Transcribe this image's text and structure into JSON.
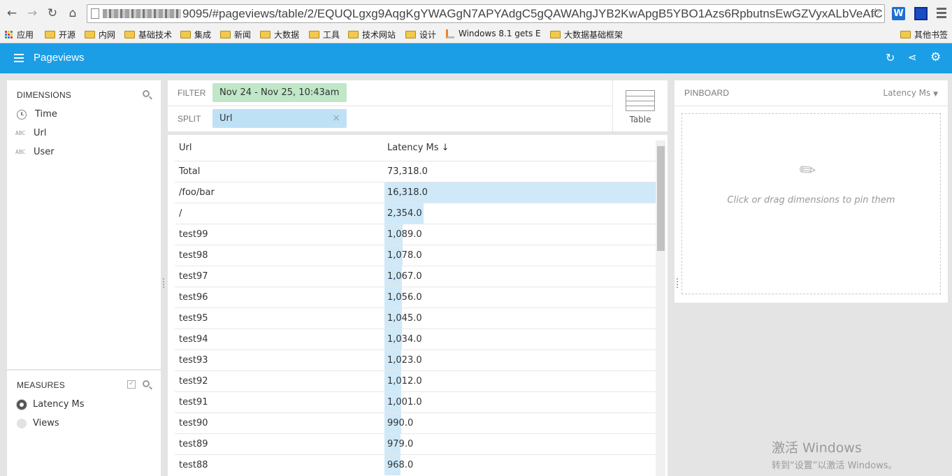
{
  "browser": {
    "url_visible": "9095/#pageviews/table/2/EQUQLgxg9AqgKgYWAGgN7APYAdgC5gQAWAhgJYB2KwApgB5YBO1Azs6RpbutnsEwGZVyxALbVeAfC",
    "bookmarks": [
      "应用",
      "开源",
      "内网",
      "基础技术",
      "集成",
      "新闻",
      "大数据",
      "工具",
      "技术网站",
      "设计",
      "Windows 8.1 gets E",
      "大数据基础框架",
      "其他书签"
    ]
  },
  "app": {
    "title": "Pageviews"
  },
  "dimensions": {
    "title": "DIMENSIONS",
    "items": [
      {
        "icon": "clock-icon",
        "label": "Time"
      },
      {
        "icon": "abc-icon",
        "icon_text": "ABC",
        "label": "Url"
      },
      {
        "icon": "abc-icon",
        "icon_text": "ABC",
        "label": "User"
      }
    ]
  },
  "measures": {
    "title": "MEASURES",
    "items": [
      {
        "label": "Latency Ms",
        "selected": true
      },
      {
        "label": "Views",
        "selected": false
      }
    ]
  },
  "filter": {
    "label": "FILTER",
    "value": "Nov 24 - Nov 25, 10:43am"
  },
  "split": {
    "label": "SPLIT",
    "value": "Url",
    "remove": "×"
  },
  "viz": {
    "label": "Table"
  },
  "table": {
    "col_url": "Url",
    "col_measure": "Latency Ms",
    "sort_glyph": "↓",
    "max_value": 16318,
    "rows": [
      {
        "url": "Total",
        "value": "73,318.0",
        "num": 0
      },
      {
        "url": "/foo/bar",
        "value": "16,318.0",
        "num": 16318
      },
      {
        "url": "/",
        "value": "2,354.0",
        "num": 2354
      },
      {
        "url": "test99",
        "value": "1,089.0",
        "num": 1089
      },
      {
        "url": "test98",
        "value": "1,078.0",
        "num": 1078
      },
      {
        "url": "test97",
        "value": "1,067.0",
        "num": 1067
      },
      {
        "url": "test96",
        "value": "1,056.0",
        "num": 1056
      },
      {
        "url": "test95",
        "value": "1,045.0",
        "num": 1045
      },
      {
        "url": "test94",
        "value": "1,034.0",
        "num": 1034
      },
      {
        "url": "test93",
        "value": "1,023.0",
        "num": 1023
      },
      {
        "url": "test92",
        "value": "1,012.0",
        "num": 1012
      },
      {
        "url": "test91",
        "value": "1,001.0",
        "num": 1001
      },
      {
        "url": "test90",
        "value": "990.0",
        "num": 990
      },
      {
        "url": "test89",
        "value": "979.0",
        "num": 979
      },
      {
        "url": "test88",
        "value": "968.0",
        "num": 968
      }
    ]
  },
  "pinboard": {
    "title": "PINBOARD",
    "measure": "Latency Ms",
    "hint": "Click or drag dimensions to pin them"
  },
  "os_watermark": {
    "line1": "激活 Windows",
    "line2": "转到“设置”以激活 Windows。"
  },
  "colors": {
    "accent": "#1b9ee6",
    "filter_pill": "#bfe7c8",
    "split_pill": "#bfe1f6",
    "bar": "#cfe9f8"
  }
}
